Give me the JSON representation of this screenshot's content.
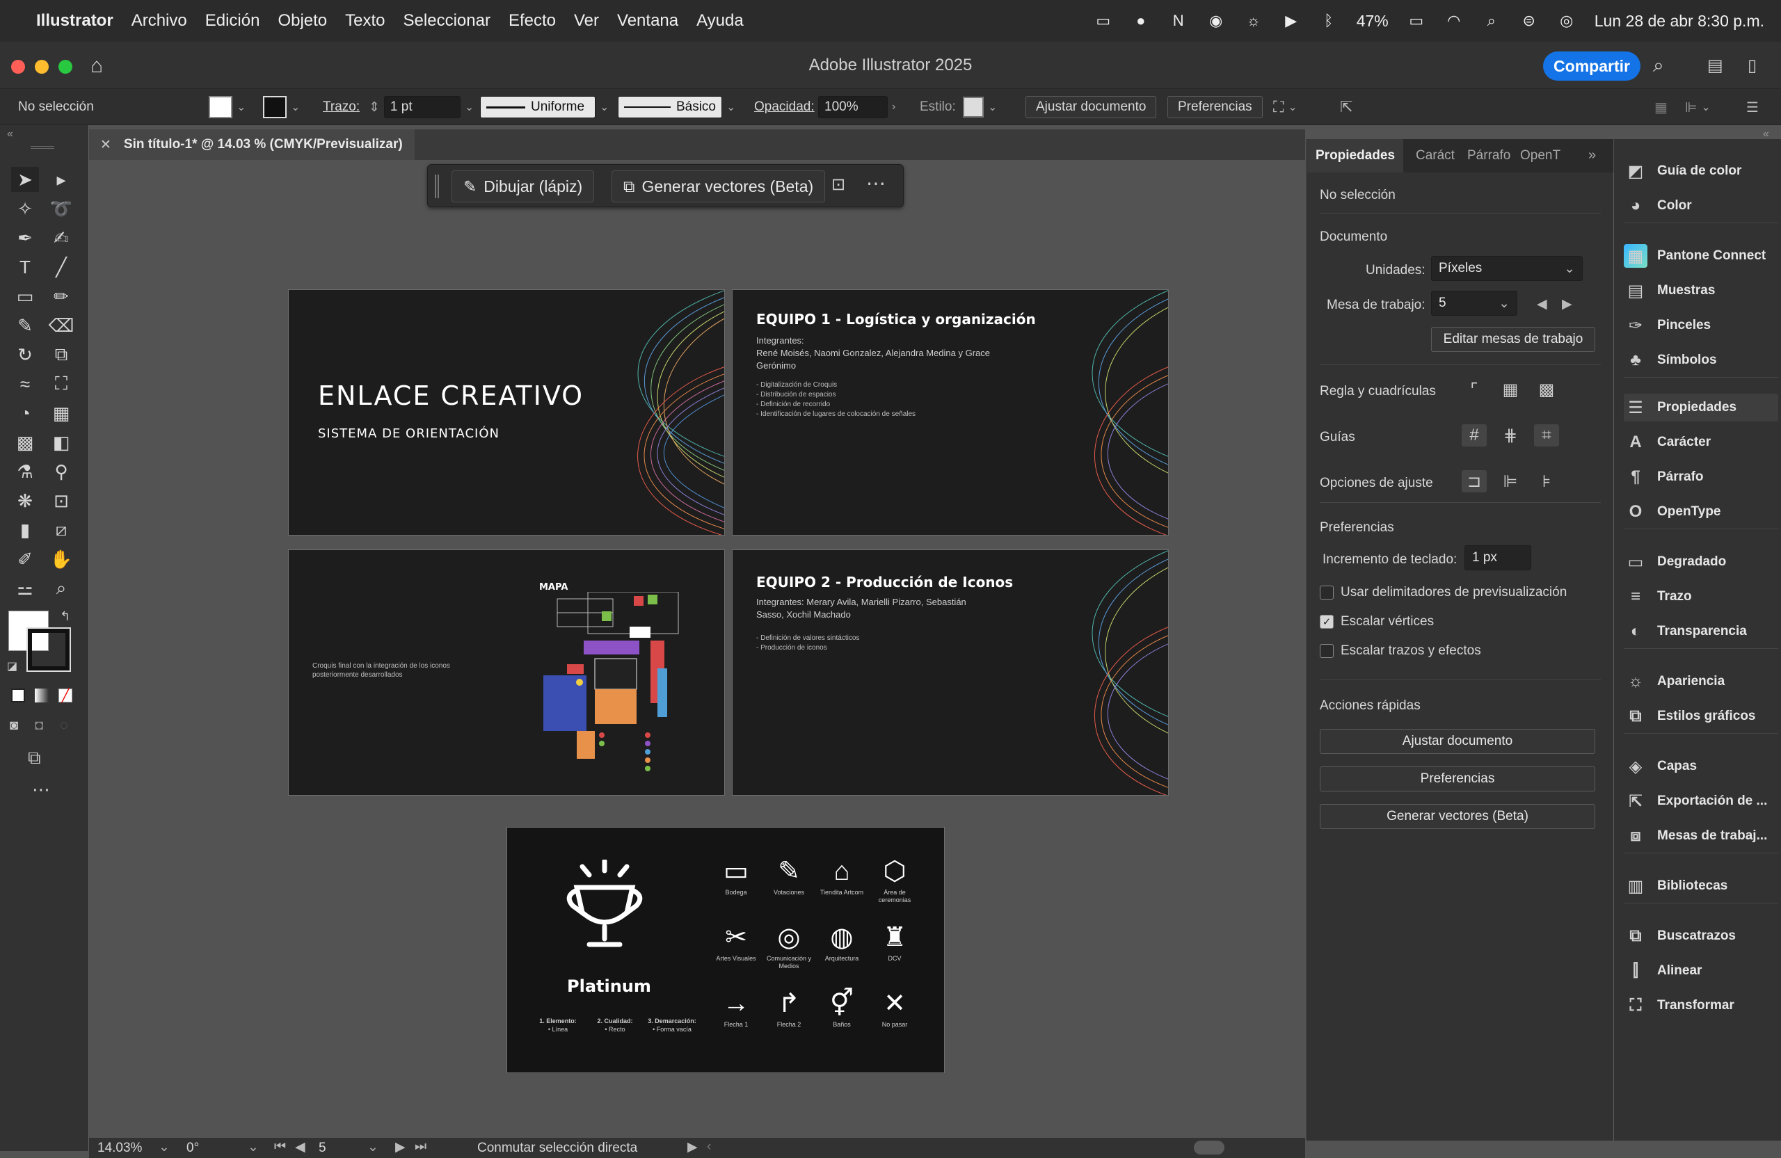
{
  "menubar": {
    "app": "Illustrator",
    "items": [
      "Archivo",
      "Edición",
      "Objeto",
      "Texto",
      "Seleccionar",
      "Efecto",
      "Ver",
      "Ventana",
      "Ayuda"
    ],
    "battery": "47%",
    "datetime": "Lun 28 de abr  8:30 p.m."
  },
  "window": {
    "title": "Adobe Illustrator 2025",
    "share": "Compartir"
  },
  "controlbar": {
    "selection": "No selección",
    "stroke_label": "Trazo:",
    "stroke_value": "1 pt",
    "profile": "Uniforme",
    "brush": "Básico",
    "opacity_label": "Opacidad:",
    "opacity_value": "100%",
    "style_label": "Estilo:",
    "fit_doc": "Ajustar documento",
    "preferences": "Preferencias"
  },
  "doc_tab": {
    "title": "Sin título-1* @ 14.03 % (CMYK/Previsualizar)"
  },
  "context_bar": {
    "draw": "Dibujar (lápiz)",
    "vectors": "Generar vectores (Beta)"
  },
  "artboards": {
    "a1": {
      "title": "ENLACE CREATIVO",
      "subtitle": "SISTEMA DE ORIENTACIÓN"
    },
    "a2": {
      "title": "EQUIPO 1 - Logística y organización",
      "members_label": "Integrantes:",
      "members": "René Moisés, Naomi Gonzalez, Alejandra Medina y Grace Gerónimo",
      "bullets": [
        "- Digitalización de Croquis",
        "- Distribución de espacios",
        "- Definición de recorrido",
        "- Identificación de lugares de colocación de señales"
      ]
    },
    "a3": {
      "map_title": "MAPA",
      "caption": "Croquis final con la integración de los iconos posteriormente desarrollados"
    },
    "a4": {
      "title": "EQUIPO 2 - Producción de Iconos",
      "members": "Integrantes: Merary Avila, Marielli Pizarro, Sebastián Sasso, Xochil Machado",
      "bullets": [
        "- Definición de valores sintácticos",
        "- Producción de iconos"
      ]
    },
    "a5": {
      "brand": "Platinum",
      "legend": [
        {
          "title": "1. Elemento:",
          "value": "• Línea"
        },
        {
          "title": "2. Cualidad:",
          "value": "• Recto"
        },
        {
          "title": "3. Demarcación:",
          "value": "• Forma vacía"
        }
      ],
      "icons": [
        {
          "glyph": "▭",
          "label": "Bodega"
        },
        {
          "glyph": "✎",
          "label": "Votaciones"
        },
        {
          "glyph": "⌂",
          "label": "Tiendita Artcom"
        },
        {
          "glyph": "⬡",
          "label": "Área de ceremonias"
        },
        {
          "glyph": "✂",
          "label": "Artes Visuales"
        },
        {
          "glyph": "◎",
          "label": "Comunicación y Medios"
        },
        {
          "glyph": "◍",
          "label": "Arquitectura"
        },
        {
          "glyph": "♜",
          "label": "DCV"
        },
        {
          "glyph": "→",
          "label": "Flecha 1"
        },
        {
          "glyph": "↱",
          "label": "Flecha 2"
        },
        {
          "glyph": "⚥",
          "label": "Baños"
        },
        {
          "glyph": "✕",
          "label": "No pasar"
        }
      ]
    }
  },
  "properties": {
    "tabs": [
      "Propiedades",
      "Caráct",
      "Párrafo",
      "OpenT"
    ],
    "no_selection": "No selección",
    "document": "Documento",
    "units_label": "Unidades:",
    "units_value": "Píxeles",
    "artboard_label": "Mesa de trabajo:",
    "artboard_value": "5",
    "edit_artboards": "Editar mesas de trabajo",
    "rulers_grids": "Regla y cuadrículas",
    "guides": "Guías",
    "snap_options": "Opciones de ajuste",
    "preferences": "Preferencias",
    "keyboard_inc_label": "Incremento de teclado:",
    "keyboard_inc_value": "1 px",
    "checks": [
      {
        "label": "Usar delimitadores de previsualización",
        "checked": false
      },
      {
        "label": "Escalar vértices",
        "checked": true
      },
      {
        "label": "Escalar trazos y efectos",
        "checked": false
      }
    ],
    "quick_actions": "Acciones rápidas",
    "qa_buttons": [
      "Ajustar documento",
      "Preferencias",
      "Generar vectores (Beta)"
    ]
  },
  "dock": [
    {
      "icon": "color-guide-icon",
      "glyph": "◩",
      "label": "Guía de color"
    },
    {
      "icon": "color-icon",
      "glyph": "◕",
      "label": "Color"
    },
    {
      "icon": "pantone-icon",
      "glyph": "▦",
      "label": "Pantone Connect"
    },
    {
      "icon": "swatches-icon",
      "glyph": "▤",
      "label": "Muestras"
    },
    {
      "icon": "brushes-icon",
      "glyph": "✑",
      "label": "Pinceles"
    },
    {
      "icon": "symbols-icon",
      "glyph": "♣",
      "label": "Símbolos"
    },
    {
      "icon": "properties-icon",
      "glyph": "☰",
      "label": "Propiedades"
    },
    {
      "icon": "character-icon",
      "glyph": "A",
      "label": "Carácter"
    },
    {
      "icon": "paragraph-icon",
      "glyph": "¶",
      "label": "Párrafo"
    },
    {
      "icon": "opentype-icon",
      "glyph": "O",
      "label": "OpenType"
    },
    {
      "icon": "gradient-icon",
      "glyph": "▭",
      "label": "Degradado"
    },
    {
      "icon": "stroke-icon",
      "glyph": "≡",
      "label": "Trazo"
    },
    {
      "icon": "transparency-icon",
      "glyph": "◐",
      "label": "Transparencia"
    },
    {
      "icon": "appearance-icon",
      "glyph": "☼",
      "label": "Apariencia"
    },
    {
      "icon": "graphic-styles-icon",
      "glyph": "⧉",
      "label": "Estilos gráficos"
    },
    {
      "icon": "layers-icon",
      "glyph": "◈",
      "label": "Capas"
    },
    {
      "icon": "export-icon",
      "glyph": "⇱",
      "label": "Exportación de ..."
    },
    {
      "icon": "artboards-icon",
      "glyph": "⧈",
      "label": "Mesas de trabaj..."
    },
    {
      "icon": "libraries-icon",
      "glyph": "▥",
      "label": "Bibliotecas"
    },
    {
      "icon": "pathfinder-icon",
      "glyph": "⧉",
      "label": "Buscatrazos"
    },
    {
      "icon": "align-icon",
      "glyph": "⫿",
      "label": "Alinear"
    },
    {
      "icon": "transform-icon",
      "glyph": "⛶",
      "label": "Transformar"
    }
  ],
  "statusbar": {
    "zoom": "14.03%",
    "rotation": "0°",
    "artboard": "5",
    "tool_hint": "Conmutar selección directa"
  }
}
